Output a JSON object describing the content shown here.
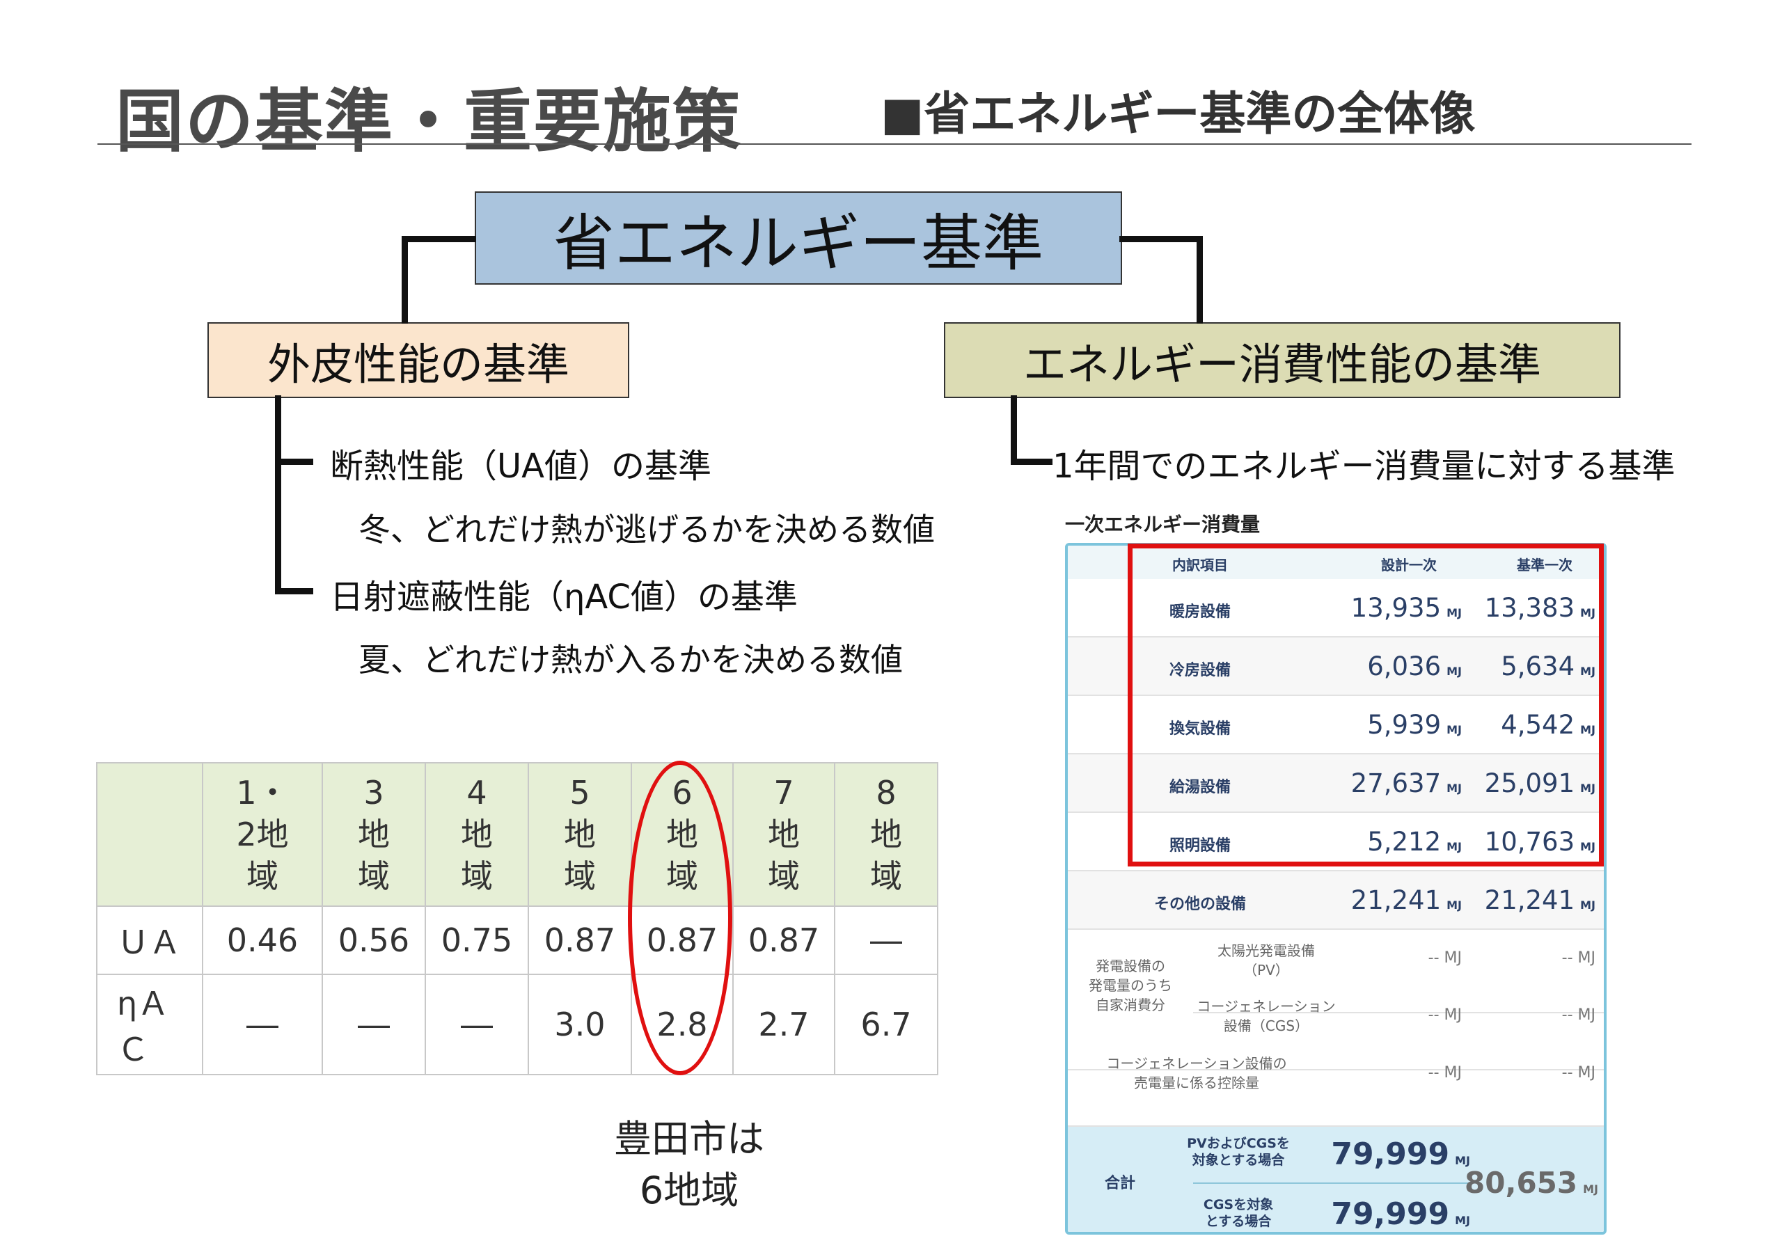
{
  "slide": {
    "title": "国の基準・重要施策",
    "subtitle": "■省エネルギー基準の全体像"
  },
  "diagram": {
    "root": "省エネルギー基準",
    "left_branch": "外皮性能の基準",
    "right_branch": "エネルギー消費性能の基準",
    "left_items": [
      {
        "label": "断熱性能（UA値）の基準",
        "desc": "冬、どれだけ熱が逃げるかを決める数値"
      },
      {
        "label": "日射遮蔽性能（ηAC値）の基準",
        "desc": "夏、どれだけ熱が入るかを決める数値"
      }
    ],
    "right_item": "1年間でのエネルギー消費量に対する基準"
  },
  "zone_table": {
    "headers": [
      "",
      "1・\n2地\n域",
      "3\n地\n域",
      "4\n地\n域",
      "5\n地\n域",
      "6\n地\n域",
      "7\n地\n域",
      "8\n地\n域"
    ],
    "rows": [
      {
        "label": "ＵＡ",
        "values": [
          "0.46",
          "0.56",
          "0.75",
          "0.87",
          "0.87",
          "0.87",
          "―"
        ]
      },
      {
        "label": "ηＡ\nＣ",
        "values": [
          "―",
          "―",
          "―",
          "3.0",
          "2.8",
          "2.7",
          "6.7"
        ]
      }
    ],
    "highlight_column": "6地域",
    "caption": "豊田市は\n6地域"
  },
  "energy": {
    "title": "一次エネルギー消費量",
    "headers": {
      "item": "内訳項目",
      "design": "設計一次",
      "standard": "基準一次"
    },
    "unit": "MJ",
    "rows": [
      {
        "label": "暖房設備",
        "design": "13,935",
        "standard": "13,383"
      },
      {
        "label": "冷房設備",
        "design": "6,036",
        "standard": "5,634"
      },
      {
        "label": "換気設備",
        "design": "5,939",
        "standard": "4,542"
      },
      {
        "label": "給湯設備",
        "design": "27,637",
        "standard": "25,091"
      },
      {
        "label": "照明設備",
        "design": "5,212",
        "standard": "10,763"
      },
      {
        "label": "その他の設備",
        "design": "21,241",
        "standard": "21,241"
      }
    ],
    "generation": {
      "group_label": "発電設備の\n発電量のうち\n自家消費分",
      "pv_label": "太陽光発電設備\n（PV）",
      "cgs_label": "コージェネレーション\n設備（CGS）",
      "dash": "-- MJ"
    },
    "cgs_sale_label": "コージェネレーション設備の\n売電量に係る控除量",
    "total": {
      "label": "合計",
      "pv_cgs_label": "PVおよびCGSを\n対象とする場合",
      "pv_cgs_value": "79,999",
      "cgs_label": "CGSを対象\nとする場合",
      "cgs_value": "79,999",
      "standard_value": "80,653"
    }
  },
  "colors": {
    "root_box": "#aac4dd",
    "left_box": "#fbe5cd",
    "right_box": "#dcdcb4",
    "highlight": "#e01010",
    "panel_border": "#7cc4dc",
    "table_header": "#e6efd6"
  }
}
